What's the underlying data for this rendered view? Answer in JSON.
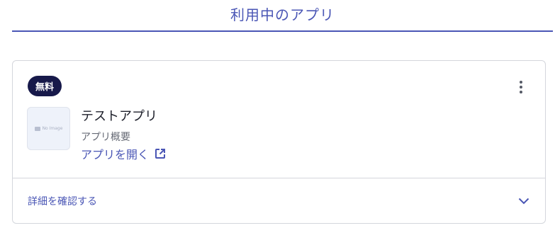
{
  "header": {
    "tab_title": "利用中のアプリ"
  },
  "app_card": {
    "badge": "無料",
    "thumbnail_text": "No Image",
    "name": "テストアプリ",
    "summary": "アプリ概要",
    "open_link_label": "アプリを開く",
    "details_label": "詳細を確認する",
    "icons": {
      "menu": "kebab-icon",
      "thumbnail": "image-icon",
      "open": "external-link-icon",
      "expand": "chevron-down-icon"
    }
  },
  "colors": {
    "accent": "#4a56b5",
    "badge_bg": "#17194a",
    "border": "#d4d6dc"
  }
}
